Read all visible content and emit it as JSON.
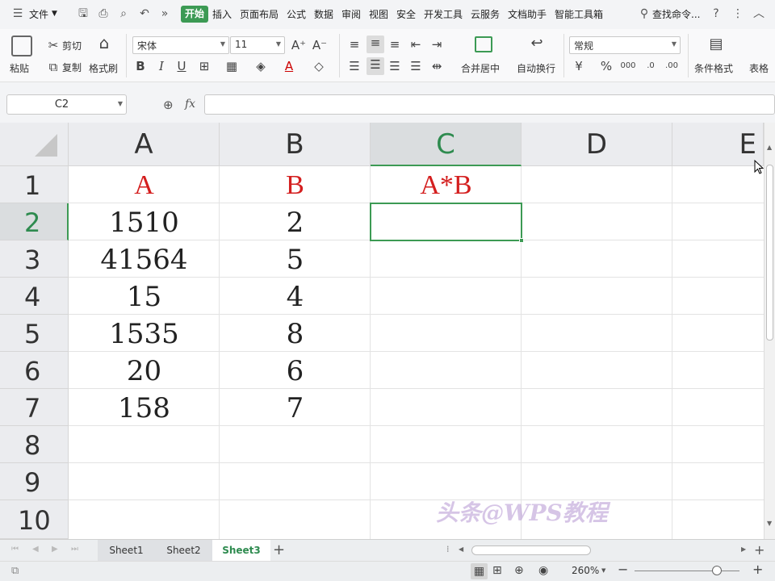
{
  "menubar": {
    "file": "文件",
    "tabs": [
      "开始",
      "插入",
      "页面布局",
      "公式",
      "数据",
      "审阅",
      "视图",
      "安全",
      "开发工具",
      "云服务",
      "文档助手",
      "智能工具箱"
    ],
    "search": "查找命令..."
  },
  "ribbon": {
    "paste": "粘贴",
    "cut": "剪切",
    "copy": "复制",
    "format_painter": "格式刷",
    "font_name": "宋体",
    "font_size": "11",
    "merge_center": "合并居中",
    "wrap_text": "自动换行",
    "number_format": "常规",
    "conditional_format": "条件格式",
    "table_style": "表格"
  },
  "formula_bar": {
    "name_box": "C2",
    "fx": "fx",
    "formula": ""
  },
  "columns": [
    "A",
    "B",
    "C",
    "D",
    "E"
  ],
  "rows": [
    "1",
    "2",
    "3",
    "4",
    "5",
    "6",
    "7",
    "8",
    "9",
    "10"
  ],
  "cells": {
    "header": [
      "A",
      "B",
      "A*B"
    ],
    "data": [
      [
        "1510",
        "2"
      ],
      [
        "41564",
        "5"
      ],
      [
        "15",
        "4"
      ],
      [
        "1535",
        "8"
      ],
      [
        "20",
        "6"
      ],
      [
        "158",
        "7"
      ]
    ]
  },
  "watermark": "头条@WPS教程",
  "sheets": [
    "Sheet1",
    "Sheet2",
    "Sheet3"
  ],
  "active_sheet": "Sheet3",
  "status": {
    "zoom": "260%"
  },
  "colors": {
    "accent": "#3c9a54",
    "header_text": "#d41f1f"
  }
}
